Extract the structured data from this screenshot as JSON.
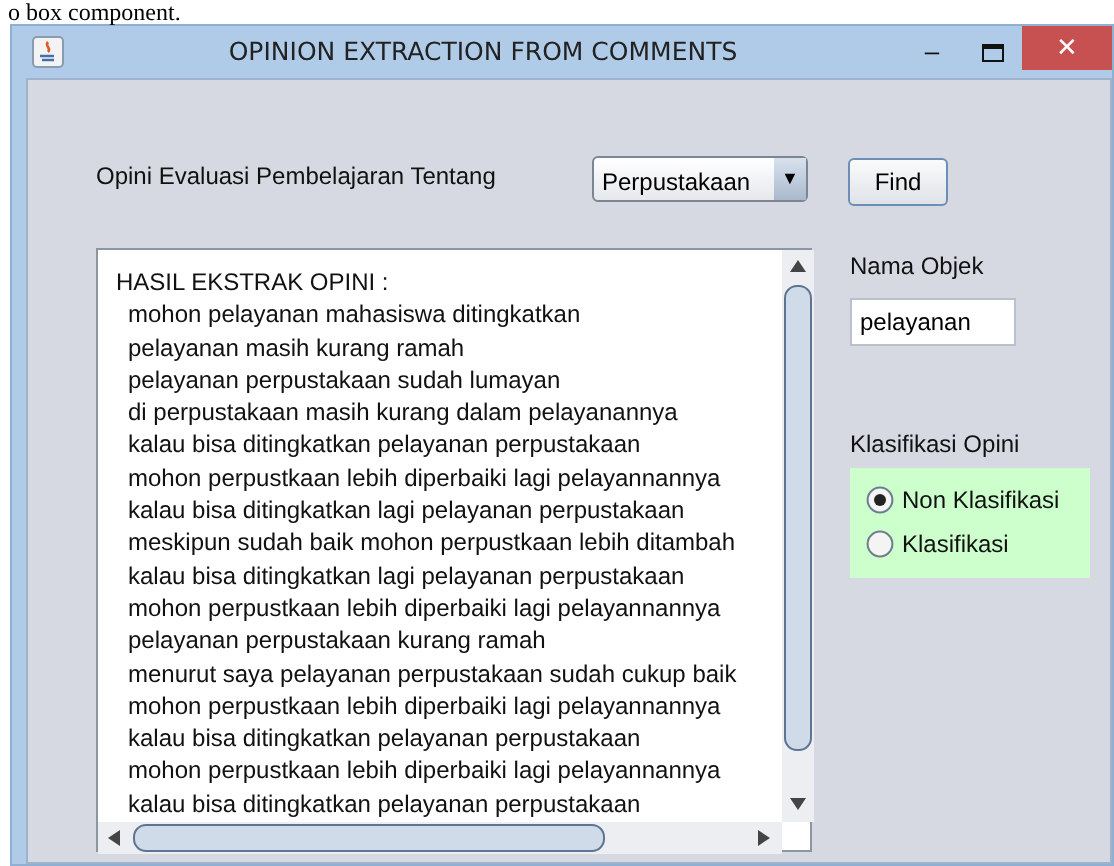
{
  "caption": "o box component.",
  "window": {
    "title": "OPINION EXTRACTION FROM COMMENTS",
    "minimize": "–",
    "close": "✕"
  },
  "query": {
    "label": "Opini Evaluasi Pembelajaran Tentang",
    "combo_value": "Perpustakaan",
    "combo_arrow": "▼",
    "find_button": "Find"
  },
  "result": {
    "heading": "HASIL EKSTRAK OPINI :",
    "lines": [
      "mohon pelayanan mahasiswa ditingkatkan",
      "pelayanan masih  kurang ramah",
      "pelayanan perpustakaan sudah lumayan",
      "di perpustakaan masih kurang dalam pelayanannya",
      "kalau bisa ditingkatkan pelayanan perpustakaan",
      "mohon perpustkaan lebih diperbaiki lagi pelayannannya",
      "kalau bisa ditingkatkan lagi pelayanan perpustakaan",
      "meskipun sudah baik mohon perpustkaan lebih ditambah",
      "kalau bisa ditingkatkan lagi pelayanan perpustakaan",
      "mohon perpustkaan lebih diperbaiki lagi pelayannannya",
      "pelayanan perpustakaan kurang ramah",
      "menurut saya  pelayanan perpustakaan sudah cukup baik",
      "mohon perpustkaan lebih diperbaiki lagi pelayannannya",
      "kalau bisa ditingkatkan pelayanan perpustakaan",
      "mohon perpustkaan lebih diperbaiki lagi pelayannannya",
      "kalau bisa ditingkatkan pelayanan perpustakaan"
    ]
  },
  "object": {
    "label": "Nama Objek",
    "value": "pelayanan"
  },
  "classification": {
    "label": "Klasifikasi Opini",
    "options": [
      {
        "label": "Non Klasifikasi",
        "selected": true
      },
      {
        "label": "Klasifikasi",
        "selected": false
      }
    ]
  }
}
